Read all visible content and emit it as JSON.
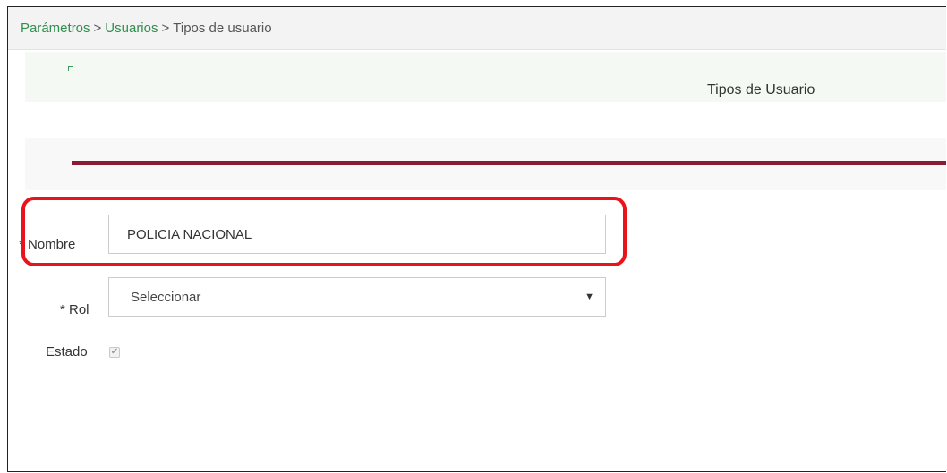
{
  "breadcrumb": {
    "items": [
      "Parámetros",
      "Usuarios"
    ],
    "separator": ">",
    "current": "Tipos de usuario"
  },
  "header": {
    "title": "Tipos de Usuario"
  },
  "form": {
    "nombre": {
      "label": "* Nombre",
      "value": "POLICIA NACIONAL"
    },
    "rol": {
      "label": "* Rol",
      "selected": "Seleccionar"
    },
    "estado": {
      "label": "Estado",
      "checked": true,
      "check_glyph": "✔"
    }
  },
  "colors": {
    "link": "#2f8f4e",
    "section_rule": "#8b1a33",
    "highlight": "#e8141b"
  }
}
